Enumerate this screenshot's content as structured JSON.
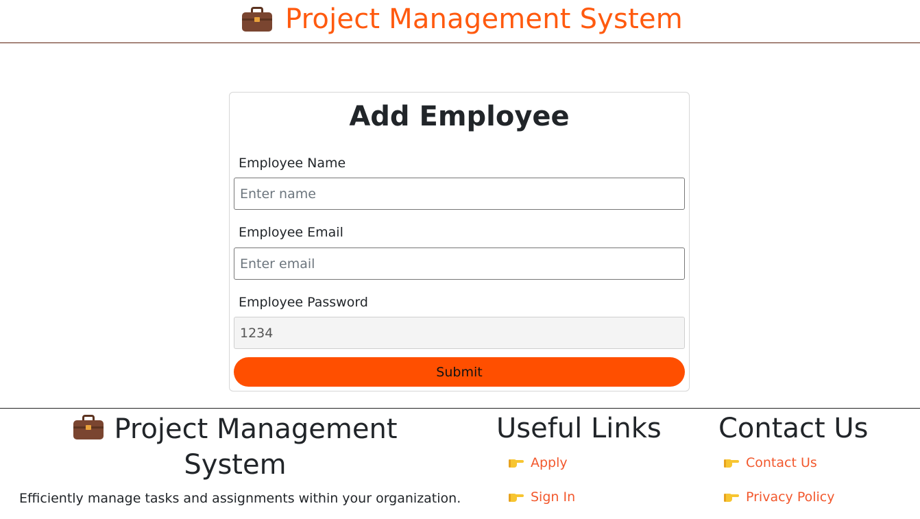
{
  "header": {
    "icon": "briefcase-icon",
    "title": "Project Management System",
    "title_color": "#ff5a0f"
  },
  "form": {
    "title": "Add Employee",
    "name_label": "Employee Name",
    "name_placeholder": "Enter name",
    "name_value": "",
    "email_label": "Employee Email",
    "email_placeholder": "Enter email",
    "email_value": "",
    "password_label": "Employee Password",
    "password_value": "1234",
    "submit_label": "Submit",
    "submit_color": "#ff4f00"
  },
  "footer": {
    "brand_icon": "briefcase-icon",
    "brand_title": "Project Management System",
    "description": "Efficiently manage tasks and assignments within your organization.",
    "useful_links_title": "Useful Links",
    "useful_links": [
      {
        "icon": "pointing-hand-icon",
        "label": "Apply"
      },
      {
        "icon": "pointing-hand-icon",
        "label": "Sign In"
      }
    ],
    "contact_title": "Contact Us",
    "contact_links": [
      {
        "icon": "pointing-hand-icon",
        "label": "Contact Us"
      },
      {
        "icon": "pointing-hand-icon",
        "label": "Privacy Policy"
      }
    ],
    "link_color": "#f2582d"
  }
}
